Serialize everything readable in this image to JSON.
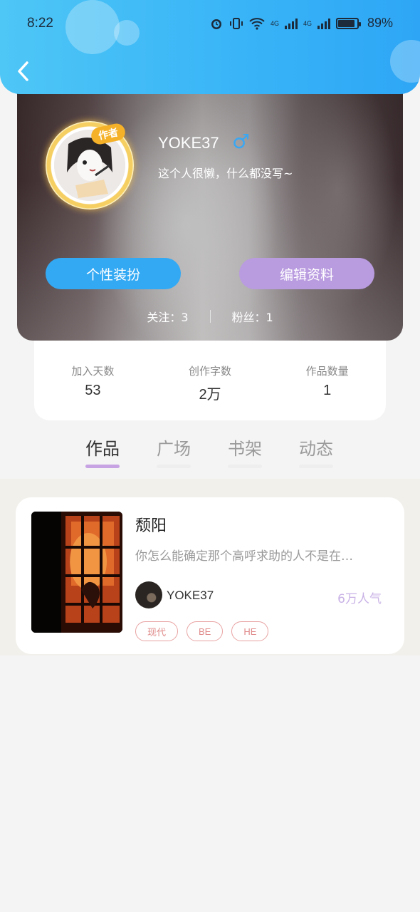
{
  "status_bar": {
    "time": "8:22",
    "battery": "89%",
    "network_1": "4G",
    "network_2": "4G"
  },
  "profile": {
    "author_badge": "作者",
    "username": "YOKE37",
    "gender_symbol": "♂",
    "bio": "这个人很懒，什么都没写~",
    "dress_up_button": "个性装扮",
    "edit_profile_button": "编辑资料",
    "follows_label": "关注：3",
    "fans_label": "粉丝：1"
  },
  "stats": [
    {
      "label": "加入天数",
      "value": "53"
    },
    {
      "label": "创作字数",
      "value": "2万"
    },
    {
      "label": "作品数量",
      "value": "1"
    }
  ],
  "tabs": [
    {
      "label": "作品",
      "active": true
    },
    {
      "label": "广场",
      "active": false
    },
    {
      "label": "书架",
      "active": false
    },
    {
      "label": "动态",
      "active": false
    }
  ],
  "book": {
    "title": "颓阳",
    "description": "你怎么能确定那个高呼求助的人不是在…",
    "author": "YOKE37",
    "popularity": "6万人气",
    "tags": [
      "现代",
      "BE",
      "HE"
    ]
  },
  "colors": {
    "header_blue": "#38b3f7",
    "dress_button": "#33a9f4",
    "edit_button": "#b99be0",
    "tab_indicator": "#c7a3e3",
    "tag_border": "#e9a3a3"
  }
}
